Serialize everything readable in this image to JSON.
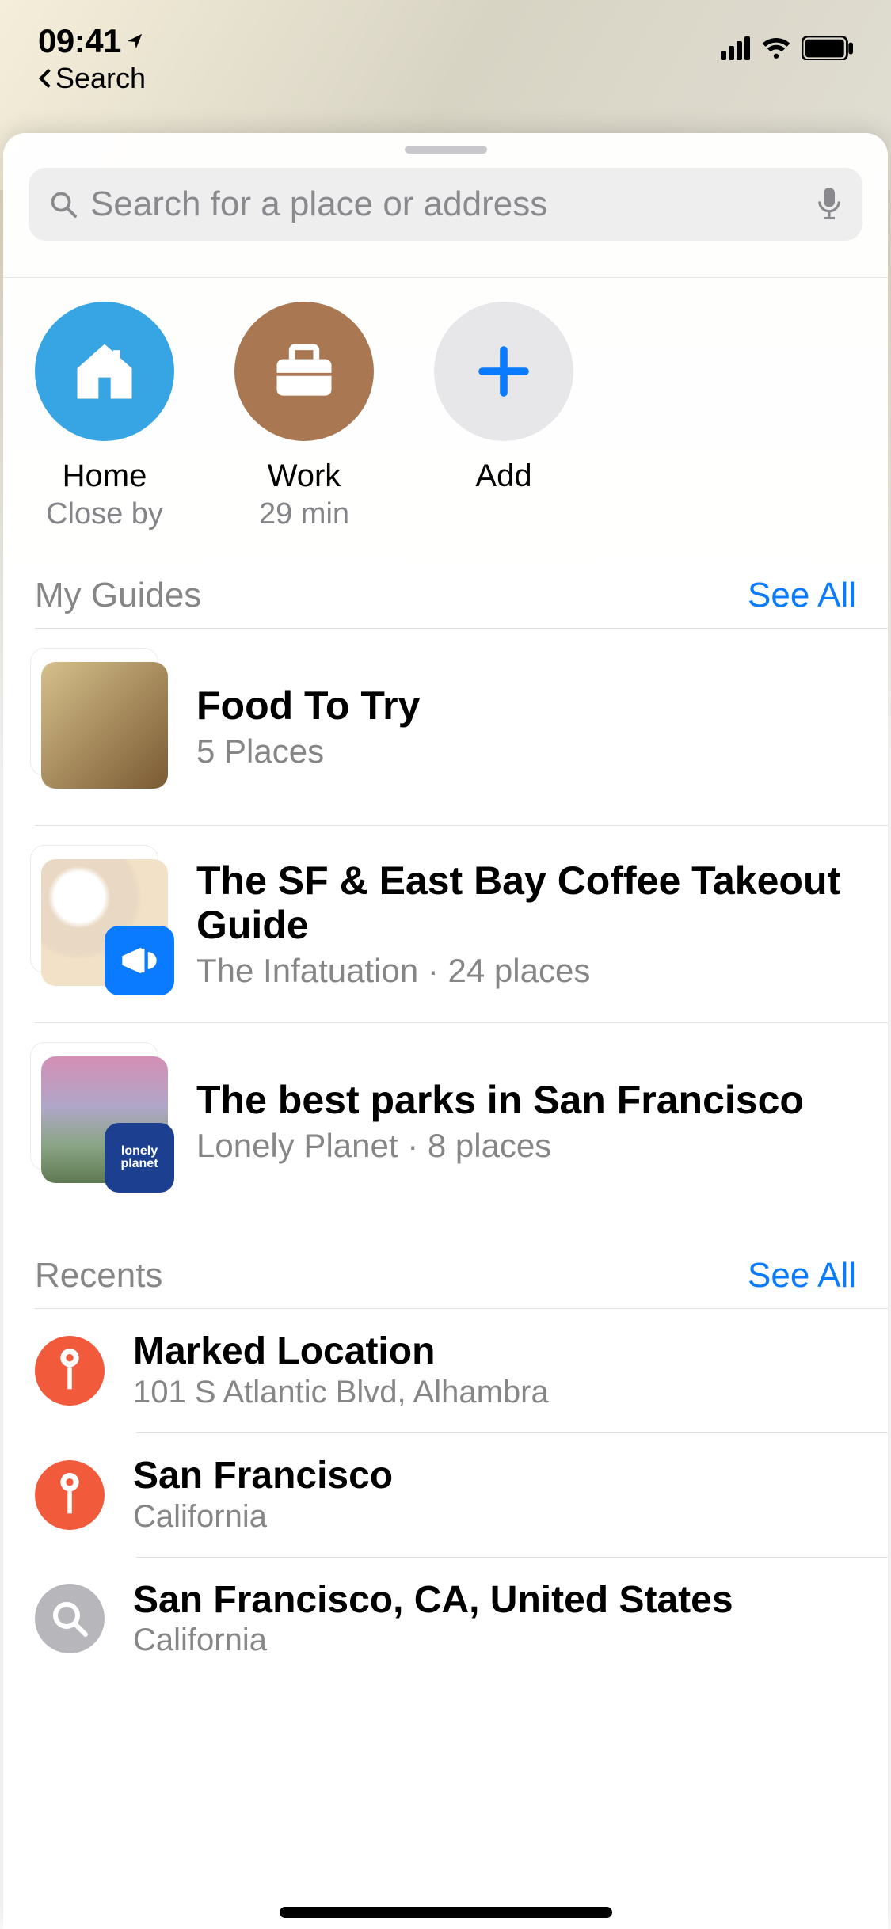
{
  "status_bar": {
    "time": "09:41",
    "back_label": "Search"
  },
  "search": {
    "placeholder": "Search for a place or address"
  },
  "favorites": [
    {
      "id": "home",
      "title": "Home",
      "subtitle": "Close by"
    },
    {
      "id": "work",
      "title": "Work",
      "subtitle": "29 min"
    },
    {
      "id": "add",
      "title": "Add",
      "subtitle": ""
    }
  ],
  "sections": {
    "guides": {
      "title": "My Guides",
      "see_all": "See All"
    },
    "recents": {
      "title": "Recents",
      "see_all": "See All"
    }
  },
  "guides": [
    {
      "title": "Food To Try",
      "subtitle": "5 Places",
      "badge": "",
      "thumb": "food"
    },
    {
      "title": "The SF & East Bay Coffee Takeout Guide",
      "subtitle": "The Infatuation · 24 places",
      "badge": "megaphone",
      "thumb": "coffee"
    },
    {
      "title": "The best parks in San Francisco",
      "subtitle": "Lonely Planet · 8 places",
      "badge": "lonely planet",
      "thumb": "park"
    }
  ],
  "recents": [
    {
      "icon": "pin",
      "title": "Marked Location",
      "subtitle": "101 S Atlantic Blvd, Alhambra"
    },
    {
      "icon": "pin",
      "title": "San Francisco",
      "subtitle": "California"
    },
    {
      "icon": "search",
      "title": "San Francisco, CA, United States",
      "subtitle": "California"
    }
  ]
}
